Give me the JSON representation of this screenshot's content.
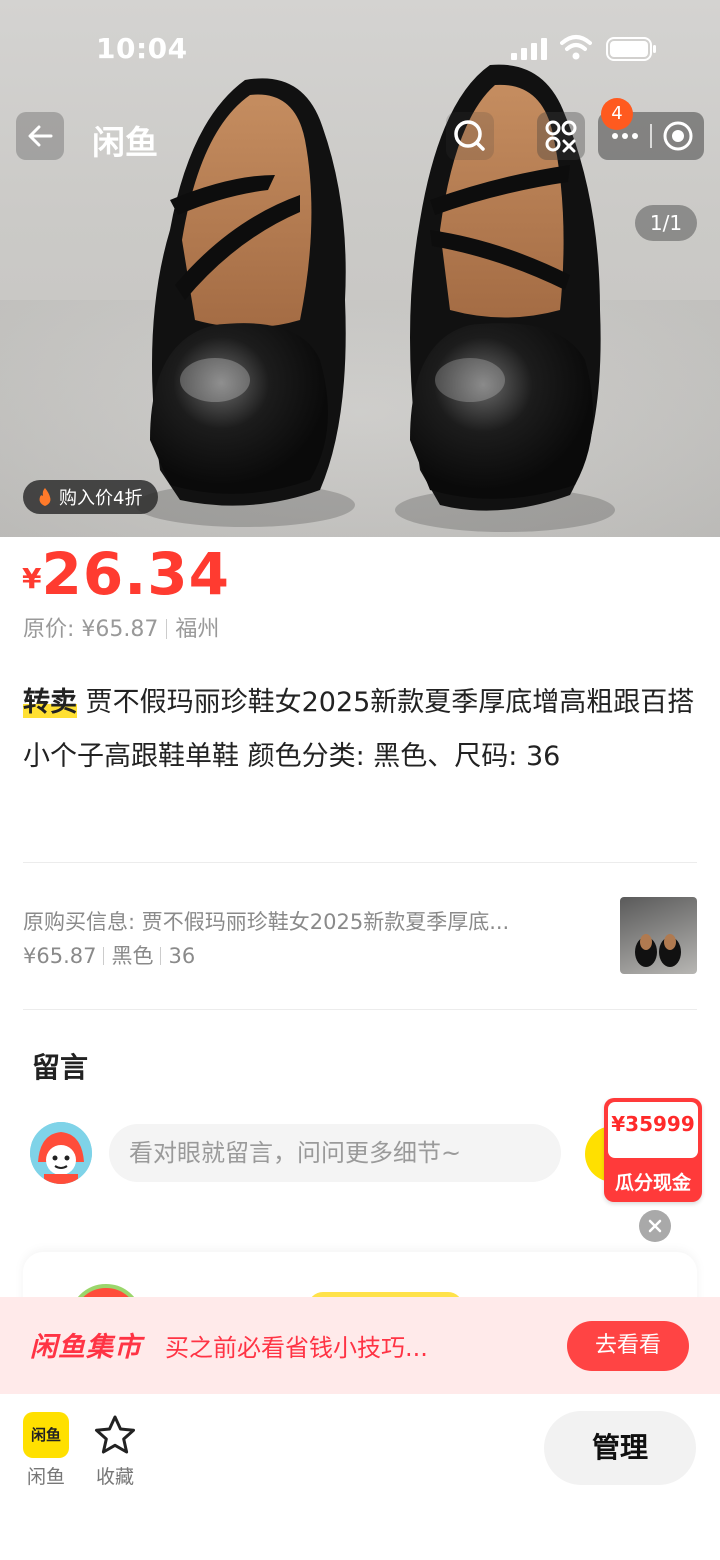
{
  "status_bar": {
    "time": "10:04"
  },
  "nav": {
    "title": "闲鱼",
    "notification_count": "4",
    "image_index": "1/1"
  },
  "hero": {
    "discount_tag": "购入价4折"
  },
  "price": {
    "currency": "¥",
    "amount": "26.34",
    "original": "原价: ¥65.87",
    "location": "福州"
  },
  "listing": {
    "tag": "转卖",
    "title": " 贾不假玛丽珍鞋女2025新款夏季厚底增高粗跟百搭小个子高跟鞋单鞋 颜色分类: 黑色、尺码: 36"
  },
  "original_purchase": {
    "label": "原购买信息: 贾不假玛丽珍鞋女2025新款夏季厚底...",
    "price": "¥65.87",
    "color": "黑色",
    "size": "36"
  },
  "comments": {
    "heading": "留言",
    "placeholder": "看对眼就留言，问问更多细节~"
  },
  "promo": {
    "amount": "¥35999",
    "label": "瓜分现金"
  },
  "banner": {
    "brand": "闲鱼集市",
    "message": "买之前必看省钱小技巧...",
    "button": "去看看"
  },
  "bottom_bar": {
    "logo_text": "闲鱼",
    "tab_xianyu": "闲鱼",
    "tab_favorite": "收藏",
    "manage_button": "管理"
  },
  "colors": {
    "price_red": "#ff3b30",
    "brand_yellow": "#ffe000",
    "badge_orange": "#ff5a1f",
    "banner_bg": "#ffeaea"
  }
}
